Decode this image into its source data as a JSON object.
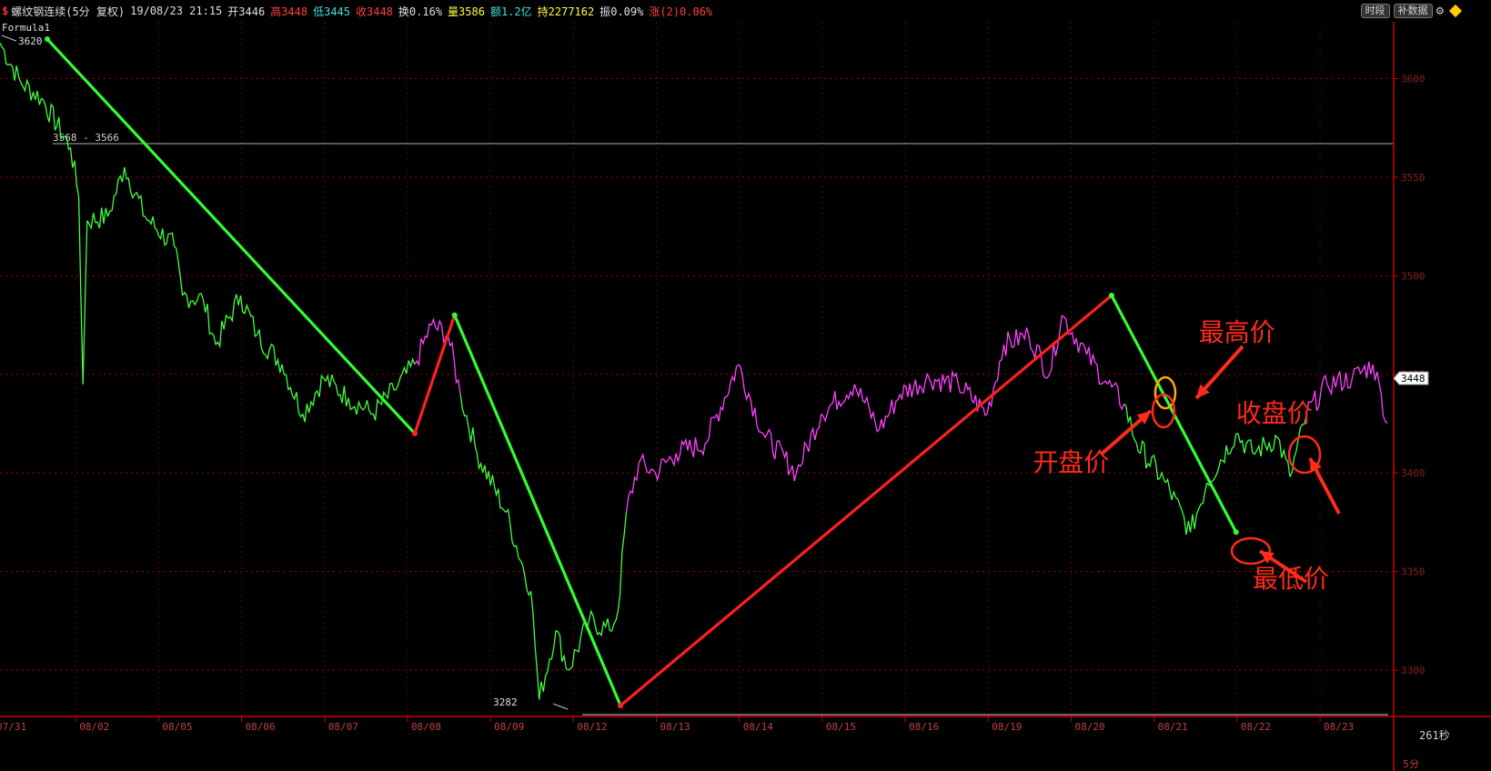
{
  "header": {
    "symbol_name": "螺纹钢连续(5分 复权)",
    "datetime": "19/08/23 21:15",
    "open": "开3446",
    "high": "高3448",
    "low": "低3445",
    "close": "收3448",
    "turnover": "换0.16%",
    "volume": "量3586",
    "amount": "额1.2亿",
    "open_interest": "持2277162",
    "amplitude": "振0.09%",
    "change": "涨(2)0.06%",
    "buttons": [
      "时段",
      "补数据"
    ]
  },
  "formula_label": "Formula1",
  "timer_label": "261秒",
  "period_label": "5分",
  "colors": {
    "up": "#ff40ff",
    "down": "#40ff40",
    "axis": "#cc0000",
    "annotation": "#ff2a1a",
    "trend_down": "#30ff30",
    "trend_up": "#ff2020",
    "highlight_ring": "#ffaa00"
  },
  "chart_data": {
    "type": "line",
    "price_axis": {
      "ticks": [
        3300,
        3350,
        3400,
        3450,
        3500,
        3550,
        3600
      ],
      "current_price": "3448"
    },
    "date_axis": {
      "ticks": [
        "07/31",
        "08/02",
        "08/05",
        "08/06",
        "08/07",
        "08/08",
        "08/09",
        "08/12",
        "08/13",
        "08/14",
        "08/15",
        "08/16",
        "08/19",
        "08/20",
        "08/21",
        "08/22",
        "08/23"
      ]
    },
    "price_series": [
      [
        0,
        3618
      ],
      [
        0.25,
        3598
      ],
      [
        0.5,
        3590
      ],
      [
        0.85,
        3565
      ],
      [
        0.95,
        3540
      ],
      [
        1.0,
        3445
      ],
      [
        1.05,
        3528
      ],
      [
        1.3,
        3530
      ],
      [
        1.5,
        3555
      ],
      [
        1.75,
        3530
      ],
      [
        2.1,
        3515
      ],
      [
        2.2,
        3490
      ],
      [
        2.45,
        3488
      ],
      [
        2.6,
        3465
      ],
      [
        2.9,
        3490
      ],
      [
        3.1,
        3470
      ],
      [
        3.4,
        3455
      ],
      [
        3.65,
        3430
      ],
      [
        3.9,
        3448
      ],
      [
        4.2,
        3438
      ],
      [
        4.5,
        3430
      ],
      [
        4.75,
        3442
      ],
      [
        5.0,
        3455
      ],
      [
        5.2,
        3475
      ],
      [
        5.4,
        3470
      ],
      [
        5.55,
        3440
      ],
      [
        5.75,
        3410
      ],
      [
        6.1,
        3380
      ],
      [
        6.4,
        3340
      ],
      [
        6.5,
        3285
      ],
      [
        6.7,
        3320
      ],
      [
        6.85,
        3300
      ],
      [
        7.1,
        3325
      ],
      [
        7.35,
        3320
      ],
      [
        7.45,
        3330
      ],
      [
        7.55,
        3380
      ],
      [
        7.7,
        3405
      ],
      [
        7.9,
        3400
      ],
      [
        8.15,
        3410
      ],
      [
        8.5,
        3415
      ],
      [
        8.9,
        3455
      ],
      [
        9.2,
        3420
      ],
      [
        9.6,
        3400
      ],
      [
        9.9,
        3430
      ],
      [
        10.3,
        3445
      ],
      [
        10.6,
        3422
      ],
      [
        10.85,
        3440
      ],
      [
        11.2,
        3448
      ],
      [
        11.55,
        3445
      ],
      [
        11.9,
        3430
      ],
      [
        12.1,
        3465
      ],
      [
        12.4,
        3470
      ],
      [
        12.65,
        3450
      ],
      [
        12.8,
        3480
      ],
      [
        13.1,
        3460
      ],
      [
        13.35,
        3445
      ],
      [
        13.55,
        3435
      ],
      [
        13.7,
        3415
      ],
      [
        14.05,
        3395
      ],
      [
        14.35,
        3370
      ],
      [
        14.55,
        3395
      ],
      [
        14.9,
        3420
      ],
      [
        15.1,
        3410
      ],
      [
        15.4,
        3418
      ],
      [
        15.55,
        3398
      ],
      [
        15.75,
        3430
      ],
      [
        16.0,
        3445
      ],
      [
        16.3,
        3448
      ],
      [
        16.55,
        3455
      ],
      [
        16.65,
        3440
      ],
      [
        16.72,
        3425
      ]
    ],
    "trend_lines": [
      {
        "color": "trend_down",
        "from": [
          0.57,
          3620
        ],
        "to": [
          5.0,
          3420
        ]
      },
      {
        "color": "trend_up",
        "from": [
          5.0,
          3420
        ],
        "to": [
          5.48,
          3480
        ]
      },
      {
        "color": "trend_down",
        "from": [
          5.48,
          3480
        ],
        "to": [
          7.48,
          3282
        ]
      },
      {
        "color": "trend_up",
        "from": [
          7.48,
          3282
        ],
        "to": [
          13.4,
          3490
        ]
      },
      {
        "color": "trend_down",
        "from": [
          13.4,
          3490
        ],
        "to": [
          14.9,
          3370
        ]
      }
    ],
    "hline": {
      "price": 3567,
      "label": "3568 - 3566"
    },
    "markers": [
      {
        "label": "3620",
        "x": 0.0,
        "price": 3620
      },
      {
        "label": "3282",
        "x": 6.45,
        "price": 3282
      }
    ],
    "annotations": [
      {
        "text": "最高价",
        "x": 14.45,
        "price": 3467
      },
      {
        "text": "收盘价",
        "x": 14.9,
        "price": 3426
      },
      {
        "text": "开盘价",
        "x": 12.45,
        "price": 3401
      },
      {
        "text": "最低价",
        "x": 15.1,
        "price": 3342
      }
    ]
  }
}
